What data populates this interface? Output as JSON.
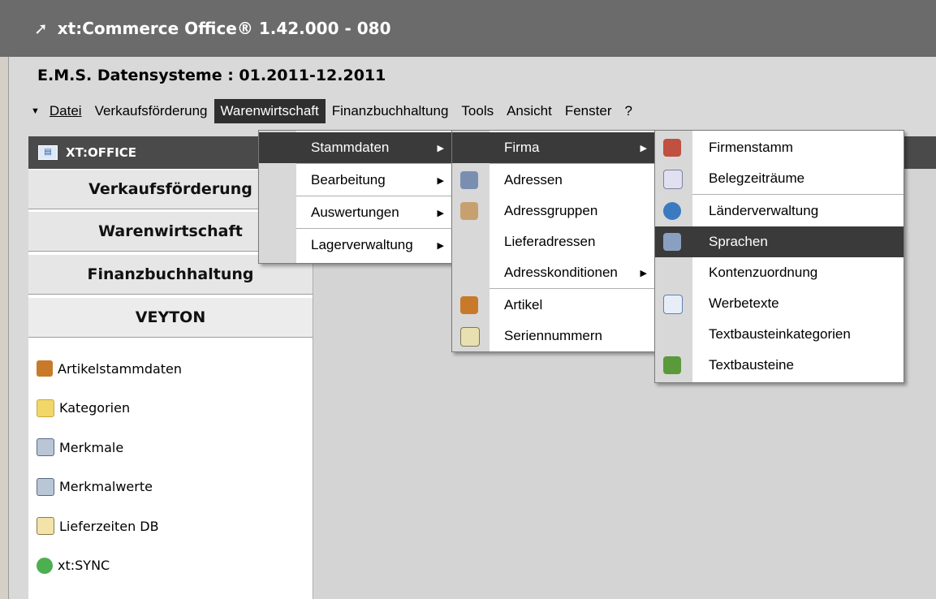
{
  "window": {
    "title": "xt:Commerce Office® 1.42.000 - 080",
    "title_icon": "arrow-icon"
  },
  "company": "E.M.S. Datensysteme : 01.2011-12.2011",
  "menubar": {
    "items": [
      {
        "label": "Datei"
      },
      {
        "label": "Verkaufsförderung"
      },
      {
        "label": "Warenwirtschaft"
      },
      {
        "label": "Finanzbuchhaltung"
      },
      {
        "label": "Tools"
      },
      {
        "label": "Ansicht"
      },
      {
        "label": "Fenster"
      },
      {
        "label": "?"
      }
    ],
    "active": "Warenwirtschaft"
  },
  "nav": {
    "header": "XT:OFFICE",
    "sections": [
      "Verkaufsförderung",
      "Warenwirtschaft",
      "Finanzbuchhaltung",
      "VEYTON"
    ],
    "items": [
      {
        "label": "Artikelstammdaten",
        "icon": "article-icon"
      },
      {
        "label": "Kategorien",
        "icon": "folder-icon"
      },
      {
        "label": "Merkmale",
        "icon": "features-icon"
      },
      {
        "label": "Merkmalwerte",
        "icon": "feature-values-icon"
      },
      {
        "label": "Lieferzeiten DB",
        "icon": "delivery-icon"
      },
      {
        "label": "xt:SYNC",
        "icon": "sync-icon"
      }
    ]
  },
  "menu1": {
    "items": [
      {
        "label": "Stammdaten",
        "has_sub": true
      },
      {
        "label": "Bearbeitung",
        "has_sub": true
      },
      {
        "label": "Auswertungen",
        "has_sub": true
      },
      {
        "label": "Lagerverwaltung",
        "has_sub": true
      }
    ],
    "highlighted": "Stammdaten"
  },
  "menu2": {
    "items": [
      {
        "label": "Firma",
        "has_sub": true
      },
      {
        "label": "Adressen",
        "icon": "address-icon"
      },
      {
        "label": "Adressgruppen",
        "icon": "address-groups-icon"
      },
      {
        "label": "Lieferadressen"
      },
      {
        "label": "Adresskonditionen",
        "has_sub": true
      },
      {
        "label": "Artikel",
        "icon": "article-icon"
      },
      {
        "label": "Seriennummern",
        "icon": "serial-icon"
      }
    ],
    "highlighted": "Firma"
  },
  "menu3": {
    "items": [
      {
        "label": "Firmenstamm",
        "icon": "house-icon"
      },
      {
        "label": "Belegzeiträume",
        "icon": "calendar-icon"
      },
      {
        "label": "Länderverwaltung",
        "icon": "globe-icon"
      },
      {
        "label": "Sprachen",
        "icon": "languages-icon"
      },
      {
        "label": "Kontenzuordnung"
      },
      {
        "label": "Werbetexte",
        "icon": "ad-text-icon"
      },
      {
        "label": "Textbausteinkategorien"
      },
      {
        "label": "Textbausteine",
        "icon": "blocks-icon"
      }
    ],
    "highlighted": "Sprachen"
  },
  "colors": {
    "titlebar": "#6b6b6b",
    "highlight": "#3a3a3a",
    "frame": "#d9d9d9"
  }
}
